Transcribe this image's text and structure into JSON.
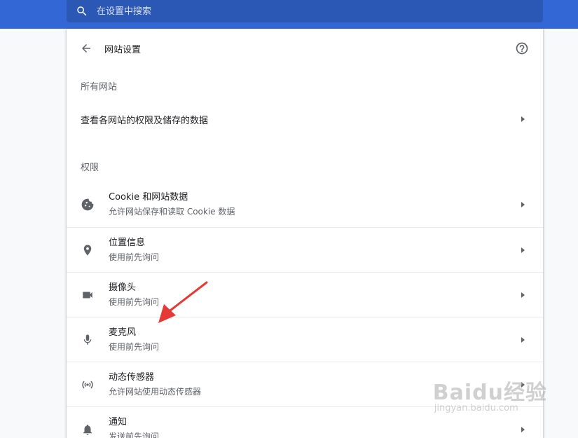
{
  "search": {
    "placeholder": "在设置中搜索"
  },
  "header": {
    "title": "网站设置"
  },
  "all_sites": {
    "section_label": "所有网站",
    "row_label": "查看各网站的权限及储存的数据"
  },
  "permissions": {
    "section_label": "权限",
    "items": [
      {
        "title": "Cookie 和网站数据",
        "subtitle": "允许网站保存和读取 Cookie 数据",
        "icon": "cookie-icon"
      },
      {
        "title": "位置信息",
        "subtitle": "使用前先询问",
        "icon": "location-icon"
      },
      {
        "title": "摄像头",
        "subtitle": "使用前先询问",
        "icon": "camera-icon"
      },
      {
        "title": "麦克风",
        "subtitle": "使用前先询问",
        "icon": "microphone-icon"
      },
      {
        "title": "动态传感器",
        "subtitle": "允许网站使用动态传感器",
        "icon": "sensors-icon"
      },
      {
        "title": "通知",
        "subtitle": "发送前先询问",
        "icon": "bell-icon"
      }
    ]
  },
  "watermark": {
    "logo": "Baidu经验",
    "url": "jingyan.baidu.com"
  },
  "colors": {
    "topbar": "#3367d6",
    "searchbox": "#2b57b5",
    "annotation_arrow": "#e53935"
  }
}
